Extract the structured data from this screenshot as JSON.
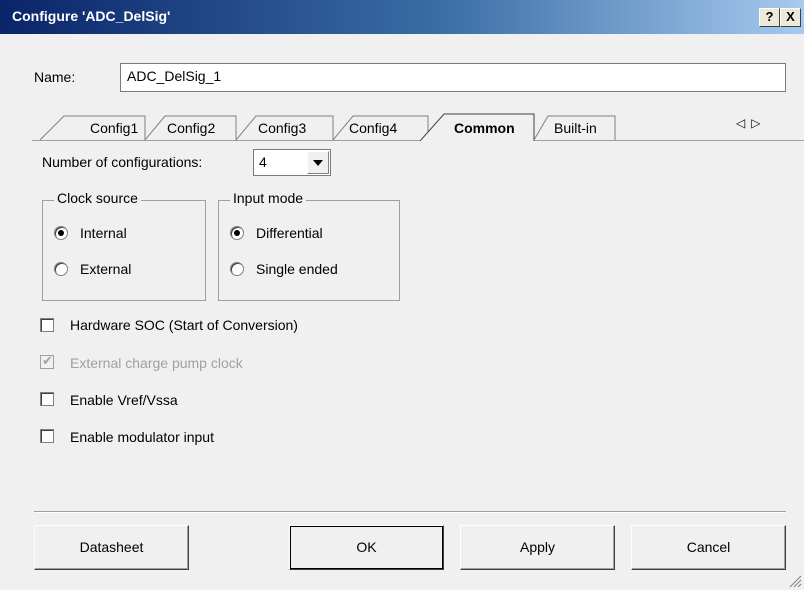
{
  "window": {
    "title": "Configure 'ADC_DelSig'",
    "help_label": "?",
    "close_label": "X"
  },
  "name_field": {
    "label": "Name:",
    "value": "ADC_DelSig_1"
  },
  "tabs": [
    {
      "label": "Config1",
      "active": false
    },
    {
      "label": "Config2",
      "active": false
    },
    {
      "label": "Config3",
      "active": false
    },
    {
      "label": "Config4",
      "active": false
    },
    {
      "label": "Common",
      "active": true
    },
    {
      "label": "Built-in",
      "active": false
    }
  ],
  "tab_scroll": {
    "left_icon": "triangle-left-icon",
    "right_icon": "triangle-right-icon"
  },
  "num_configs": {
    "label": "Number of configurations:",
    "value": "4"
  },
  "clock_source": {
    "legend": "Clock source",
    "options": [
      {
        "label": "Internal",
        "selected": true
      },
      {
        "label": "External",
        "selected": false
      }
    ]
  },
  "input_mode": {
    "legend": "Input mode",
    "options": [
      {
        "label": "Differential",
        "selected": true
      },
      {
        "label": "Single ended",
        "selected": false
      }
    ]
  },
  "checkboxes": [
    {
      "label": "Hardware SOC (Start of Conversion)",
      "checked": false,
      "enabled": true
    },
    {
      "label": "External charge pump clock",
      "checked": true,
      "enabled": false
    },
    {
      "label": "Enable Vref/Vssa",
      "checked": false,
      "enabled": true
    },
    {
      "label": "Enable modulator input",
      "checked": false,
      "enabled": true
    }
  ],
  "buttons": {
    "datasheet": "Datasheet",
    "ok": "OK",
    "apply": "Apply",
    "cancel": "Cancel"
  },
  "colors": {
    "title_start": "#0a246a",
    "title_end": "#a6caf0",
    "dialog_bg": "#f0f0f0",
    "disabled_text": "#a0a0a0"
  }
}
